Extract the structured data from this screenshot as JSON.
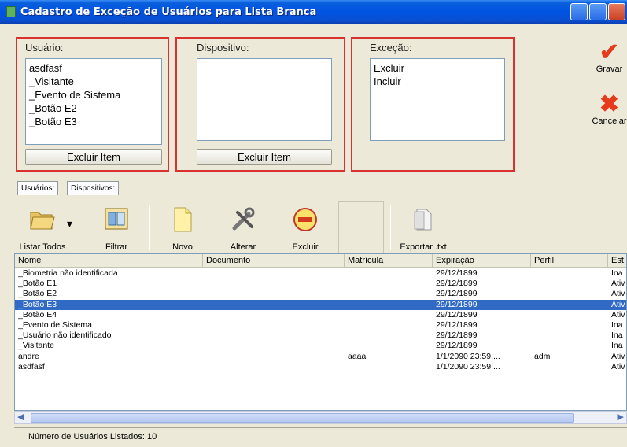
{
  "window": {
    "title": "Cadastro de Exceção de Usuários para Lista Branca"
  },
  "groups": {
    "usuario": {
      "label": "Usuário:",
      "items": [
        "asdfasf",
        "_Visitante",
        "_Evento de Sistema",
        "_Botão E2",
        "_Botão E3"
      ],
      "button": "Excluir Item"
    },
    "dispositivo": {
      "label": "Dispositivo:",
      "items": [],
      "button": "Excluir Item"
    },
    "excecao": {
      "label": "Exceção:",
      "items": [
        "Excluir",
        "Incluir"
      ]
    }
  },
  "side": {
    "save": "Gravar",
    "cancel": "Cancelar"
  },
  "tabs": [
    "Usuários:",
    "Dispositivos:"
  ],
  "toolbar": {
    "list_all": "Listar Todos",
    "filter": "Filtrar",
    "new": "Novo",
    "edit": "Alterar",
    "delete": "Excluir",
    "export": "Exportar .txt"
  },
  "grid": {
    "columns": [
      "Nome",
      "Documento",
      "Matrícula",
      "Expiração",
      "Perfil",
      "Est"
    ],
    "rows": [
      [
        "_Biometria não identificada",
        "",
        "",
        "29/12/1899",
        "",
        "Ina"
      ],
      [
        "_Botão E1",
        "",
        "",
        "29/12/1899",
        "",
        "Ativ"
      ],
      [
        "_Botão E2",
        "",
        "",
        "29/12/1899",
        "",
        "Ativ"
      ],
      [
        "_Botão E3",
        "",
        "",
        "29/12/1899",
        "",
        "Ativ"
      ],
      [
        "_Botão E4",
        "",
        "",
        "29/12/1899",
        "",
        "Ativ"
      ],
      [
        "_Evento de Sistema",
        "",
        "",
        "29/12/1899",
        "",
        "Ina"
      ],
      [
        "_Usuário não identificado",
        "",
        "",
        "29/12/1899",
        "",
        "Ina"
      ],
      [
        "_Visitante",
        "",
        "",
        "29/12/1899",
        "",
        "Ina"
      ],
      [
        "andre",
        "",
        "aaaa",
        "1/1/2090 23:59:...",
        "adm",
        "Ativ"
      ],
      [
        "asdfasf",
        "",
        "",
        "1/1/2090 23:59:...",
        "",
        "Ativ"
      ]
    ],
    "selected_row": 3
  },
  "status": {
    "text": "Número de Usuários Listados:  10"
  }
}
